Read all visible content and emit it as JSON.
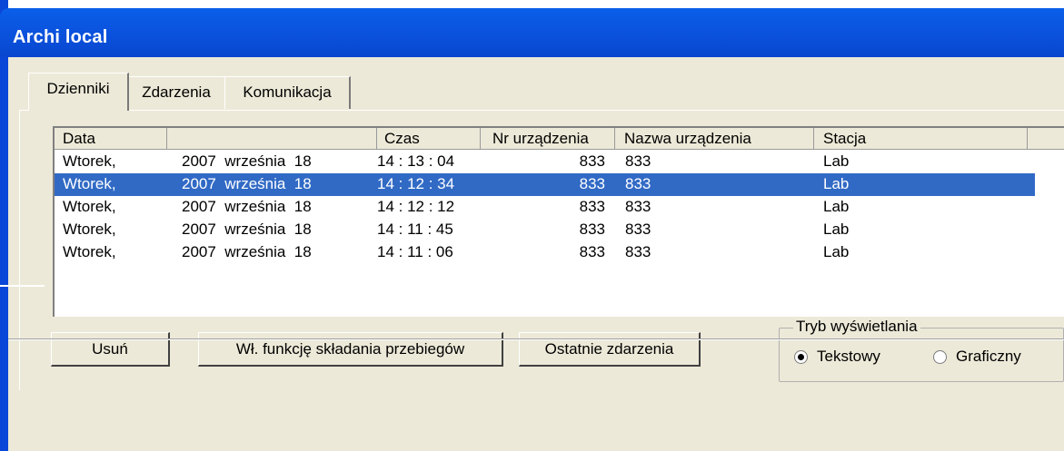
{
  "window": {
    "title": "Archi local",
    "titlebar_color": "#0b55e0"
  },
  "tabs": [
    {
      "label": "Dzienniki",
      "active": true
    },
    {
      "label": "Zdarzenia",
      "active": false
    },
    {
      "label": "Komunikacja",
      "active": false
    }
  ],
  "table": {
    "columns": [
      "Data",
      "",
      "Czas",
      "Nr urządzenia",
      "Nazwa urządzenia",
      "Stacja"
    ],
    "rows": [
      {
        "day": "Wtorek,",
        "date": "2007  września  18",
        "time": "14 : 13 : 04",
        "nr": "833",
        "name": "833",
        "station": "Lab",
        "selected": false
      },
      {
        "day": "Wtorek,",
        "date": "2007  września  18",
        "time": "14 : 12 : 34",
        "nr": "833",
        "name": "833",
        "station": "Lab",
        "selected": true
      },
      {
        "day": "Wtorek,",
        "date": "2007  września  18",
        "time": "14 : 12 : 12",
        "nr": "833",
        "name": "833",
        "station": "Lab",
        "selected": false
      },
      {
        "day": "Wtorek,",
        "date": "2007  września  18",
        "time": "14 : 11 : 45",
        "nr": "833",
        "name": "833",
        "station": "Lab",
        "selected": false
      },
      {
        "day": "Wtorek,",
        "date": "2007  września  18",
        "time": "14 : 11 : 06",
        "nr": "833",
        "name": "833",
        "station": "Lab",
        "selected": false
      }
    ],
    "selection_color": "#316ac5"
  },
  "buttons": {
    "delete": "Usuń",
    "toggle_waveforms": "Wł. funkcję składania przebiegów",
    "last_events": "Ostatnie zdarzenia"
  },
  "display_mode": {
    "label": "Tryb wyświetlania",
    "options": [
      "Tekstowy",
      "Graficzny"
    ],
    "selected": "Tekstowy"
  }
}
